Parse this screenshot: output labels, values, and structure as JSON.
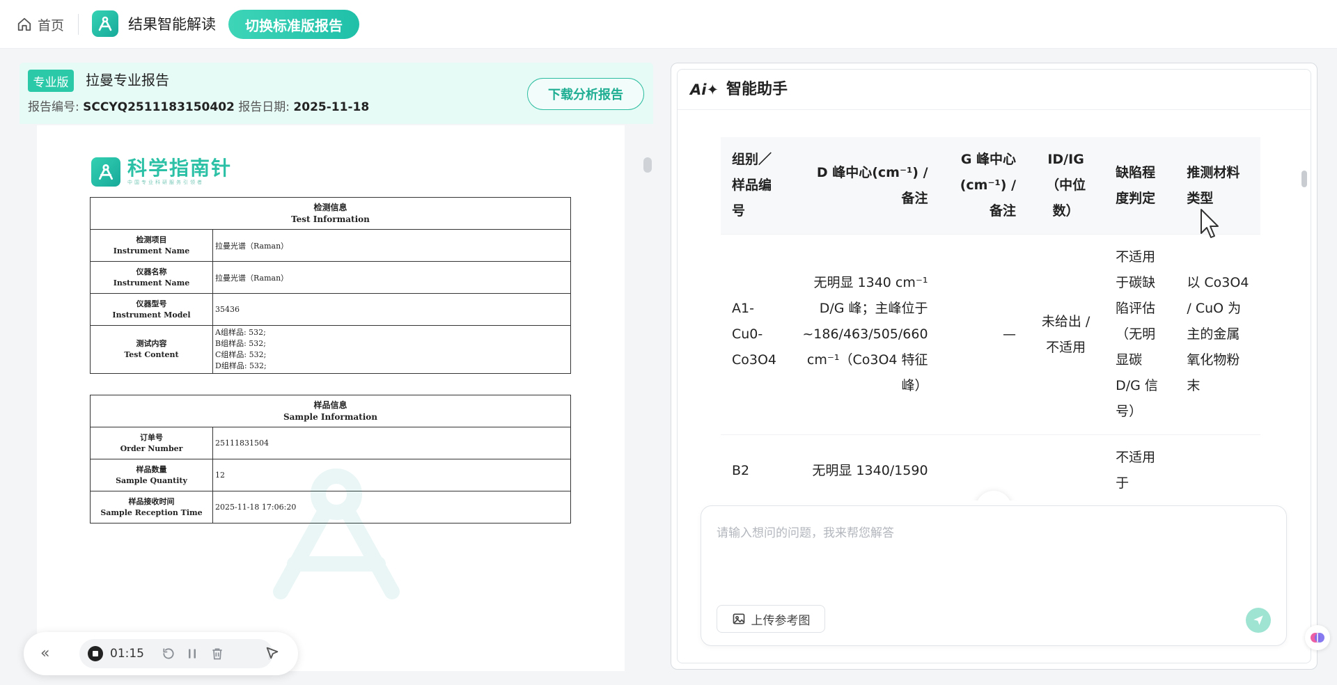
{
  "topbar": {
    "home_label": "首页",
    "app_title": "结果智能解读",
    "switch_label": "切换标准版报告"
  },
  "report": {
    "badge": "专业版",
    "title": "拉曼专业报告",
    "number_label": "报告编号:",
    "number": "SCCYQ2511183150402",
    "date_label": "报告日期:",
    "date": "2025-11-18",
    "download_label": "下载分析报告"
  },
  "doc": {
    "logo_text": "科学指南针",
    "logo_sub": "中国专业科研服务引领者",
    "test_info": {
      "header_cn": "检测信息",
      "header_en": "Test Information",
      "rows": [
        {
          "label_cn": "检测项目",
          "label_en": "Instrument Name",
          "value": "拉曼光谱（Raman）"
        },
        {
          "label_cn": "仪器名称",
          "label_en": "Instrument Name",
          "value": "拉曼光谱（Raman）"
        },
        {
          "label_cn": "仪器型号",
          "label_en": "Instrument Model",
          "value": "35436"
        }
      ],
      "content": {
        "label_cn": "测试内容",
        "label_en": "Test Content",
        "lines": [
          "A组样品: 532;",
          "B组样品: 532;",
          "C组样品: 532;",
          "D组样品: 532;"
        ]
      }
    },
    "sample_info": {
      "header_cn": "样品信息",
      "header_en": "Sample Information",
      "rows": [
        {
          "label_cn": "订单号",
          "label_en": "Order Number",
          "value": "25111831504"
        },
        {
          "label_cn": "样品数量",
          "label_en": "Sample Quantity",
          "value": "12"
        },
        {
          "label_cn": "样品接收时间",
          "label_en": "Sample Reception Time",
          "value": "2025-11-18 17:06:20"
        }
      ]
    }
  },
  "recorder": {
    "time": "01:15"
  },
  "assistant": {
    "logo": "Ai✦",
    "title": "智能助手",
    "table": {
      "headers": {
        "h1": "组别／样品编号",
        "h2": "D 峰中心(cm⁻¹) / 备注",
        "h3": "G 峰中心(cm⁻¹) / 备注",
        "h4": "ID/IG（中位数）",
        "h5": "缺陷程度判定",
        "h6": "推测材料类型"
      },
      "rows": [
        {
          "c1": "A1-Cu0-Co3O4",
          "c2": "无明显 1340 cm⁻¹ D/G 峰；主峰位于 ~186/463/505/660 cm⁻¹（Co3O4 特征峰）",
          "c3": "—",
          "c4": "未给出 / 不适用",
          "c5": "不适用于碳缺陷评估（无明显碳 D/G 信号）",
          "c6": "以 Co3O4 / CuO 为主的金属氧化物粉末"
        },
        {
          "c1": "B2",
          "c2": "无明显 1340/1590",
          "c3": "",
          "c4": "",
          "c5": "不适用于",
          "c6": ""
        }
      ]
    },
    "input_placeholder": "请输入想问的问题，我来帮您解答",
    "upload_label": "上传参考图"
  },
  "colors": {
    "accent": "#2cc9a9",
    "accent_dark": "#1fae93",
    "header_tint": "#e6faf6"
  }
}
